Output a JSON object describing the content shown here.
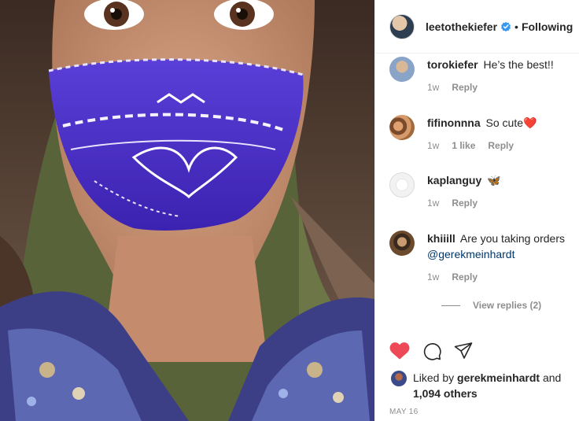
{
  "post": {
    "username": "leetothekiefer",
    "follow_status": "Following",
    "separator": "•"
  },
  "comments": [
    {
      "username": "torokiefer",
      "text": "He’s the best!!",
      "time": "1w",
      "likes": "",
      "reply": "Reply"
    },
    {
      "username": "fifinonnna",
      "text": "So cute",
      "emoji": "❤️",
      "time": "1w",
      "likes": "1 like",
      "reply": "Reply"
    },
    {
      "username": "kaplanguy",
      "text": "",
      "emoji": "🦋",
      "time": "1w",
      "likes": "",
      "reply": "Reply"
    },
    {
      "username": "khiiill",
      "text": "Are you taking orders",
      "mention": "@gerekmeinhardt",
      "time": "1w",
      "likes": "",
      "reply": "Reply"
    }
  ],
  "view_replies": "View replies (2)",
  "likes": {
    "prefix": "Liked by",
    "user": "gerekmeinhardt",
    "and": "and",
    "others": "1,094 others"
  },
  "date": "MAY 16",
  "colors": {
    "heart": "#ed4956",
    "verified": "#3897f0",
    "mention": "#00376b",
    "muted": "#8e8e8e"
  },
  "icons": [
    "verified-badge-icon",
    "heart-icon",
    "comment-icon",
    "share-icon"
  ]
}
